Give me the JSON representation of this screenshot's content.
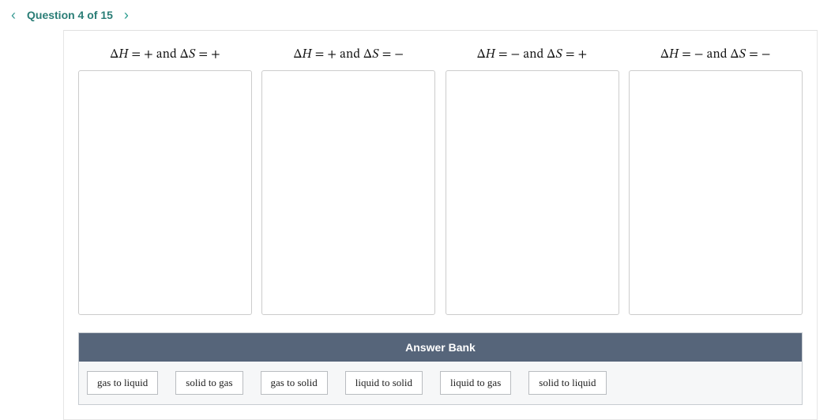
{
  "nav": {
    "prev_icon": "‹",
    "next_icon": "›",
    "question_label": "Question 4 of 15"
  },
  "bins": [
    {
      "header": "Δ𝐻 = + and Δ𝑆 = +"
    },
    {
      "header": "Δ𝐻 = + and Δ𝑆 = −"
    },
    {
      "header": "Δ𝐻 = − and Δ𝑆 = +"
    },
    {
      "header": "Δ𝐻 = − and Δ𝑆 = −"
    }
  ],
  "answer_bank": {
    "title": "Answer Bank",
    "items": [
      "gas to liquid",
      "solid to gas",
      "gas to solid",
      "liquid to solid",
      "liquid to gas",
      "solid to liquid"
    ]
  }
}
